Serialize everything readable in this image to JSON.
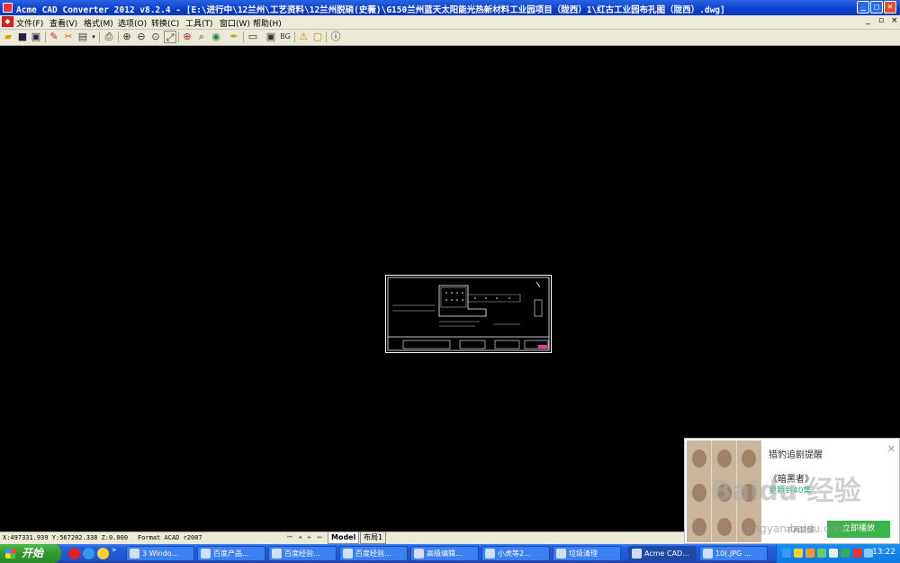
{
  "window": {
    "title": "Acme CAD Converter 2012 v8.2.4 - [E:\\进行中\\12兰州\\工艺资料\\12兰州脱硝(史薇)\\G150兰州蓝天太阳能光热新材料工业园项目（陇西）1\\红古工业园布孔图（陇西）.dwg]",
    "minimize": "_",
    "maximize": "□",
    "close": "×"
  },
  "menu": {
    "items": [
      "文件(F)",
      "查看(V)",
      "格式(M)",
      "选项(O)",
      "转换(C)",
      "工具(T)",
      "窗口(W)",
      "帮助(H)"
    ],
    "mdi": [
      "_",
      "▫",
      "×"
    ]
  },
  "toolbar": {
    "icons": [
      "open-icon",
      "save-icon",
      "save-as-icon",
      "separator",
      "convert-icon",
      "batch-icon",
      "dropdown-icon",
      "separator",
      "print-icon",
      "separator",
      "zoom-in-icon",
      "zoom-out-icon",
      "zoom-window-icon",
      "zoom-extents-icon",
      "separator",
      "zoom-realtime-icon",
      "search-icon",
      "layer-icon",
      "pen-icon",
      "separator",
      "layout-icon",
      "bg-icon",
      "separator",
      "warning-icon",
      "lock-icon",
      "separator",
      "about-icon"
    ],
    "bg_label": "BG"
  },
  "status": {
    "coords": "X:497331.939 Y:567202.338 Z:0.000",
    "format": "Format ACAD r2007",
    "tabs": [
      "Model",
      "布局1"
    ]
  },
  "popup": {
    "title": "猎豹追剧提醒",
    "show": "《暗黑者》",
    "update": "更新到40集",
    "link": "不再提醒",
    "button": "立即播放"
  },
  "watermark": {
    "main": "Baidu 经验",
    "sub": "jingyan.baidu.com"
  },
  "taskbar": {
    "start": "开始",
    "tasks": [
      "3 Windo...",
      "百度产品...",
      "百度经验...",
      "百度经验...",
      "高级编辑...",
      "小虎等2...",
      "垃圾清理",
      "Acme CAD...",
      "10(.JPG ..."
    ],
    "clock": "13:22"
  },
  "colors": {
    "titlebar": "#0a3fcf",
    "canvas": "#000000",
    "taskbar": "#245edb",
    "start": "#2f9a2f",
    "popup_button": "#3cb44b"
  }
}
